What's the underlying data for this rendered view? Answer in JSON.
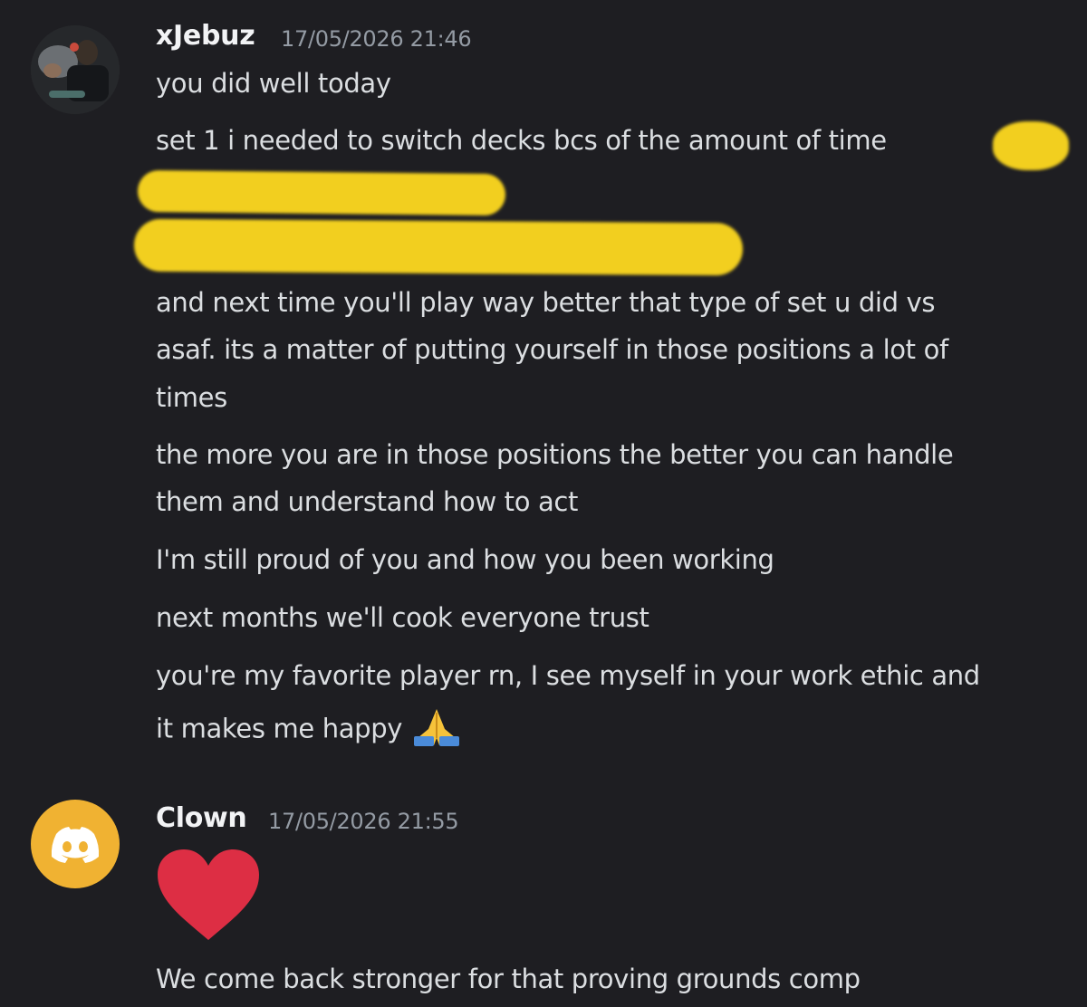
{
  "messages": [
    {
      "author": "xJebuz",
      "timestamp": "17/05/2026 21:46",
      "avatar": "user-photo-avatar",
      "lines": [
        "you did well today",
        "set 1 i needed to switch decks bcs of the amount of time",
        "and next time you'll play way better that type of set u did vs",
        "asaf. its a matter of putting yourself in those positions a lot of",
        "times",
        "the more you are in those positions the better you can handle",
        "them and understand how to act",
        "I'm still proud of you and how you been working",
        "next months we'll cook everyone trust",
        "you're my favorite player rn, I see myself in your work ethic and",
        "it makes me happy"
      ],
      "redaction_color": "#f2cf1f",
      "reaction_emoji": "folded-hands"
    },
    {
      "author": "Clown",
      "timestamp": "17/05/2026 21:55",
      "avatar": "discord-default-avatar",
      "avatar_color": "#f0b232",
      "emoji": "red-heart",
      "emoji_color": "#dd2e44",
      "lines": [
        "We come back stronger for that proving grounds comp"
      ]
    }
  ]
}
